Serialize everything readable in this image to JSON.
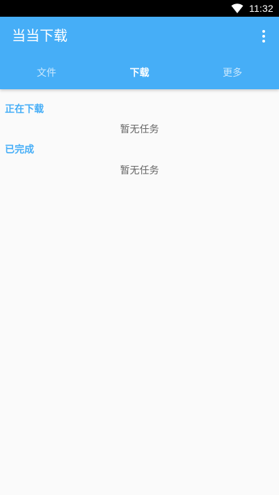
{
  "status_bar": {
    "time": "11:32",
    "icons": [
      "wifi-icon"
    ]
  },
  "app_bar": {
    "title": "当当下载",
    "menu_icon": "more-vert-icon",
    "background_color": "#46aef7"
  },
  "tabs": [
    {
      "label": "文件",
      "active": false
    },
    {
      "label": "下载",
      "active": true
    },
    {
      "label": "更多",
      "active": false
    }
  ],
  "sections": [
    {
      "title": "正在下载",
      "empty_text": "暂无任务"
    },
    {
      "title": "已完成",
      "empty_text": "暂无任务"
    }
  ],
  "colors": {
    "accent": "#46aef7",
    "background": "#fafafa",
    "status_bar": "#000000"
  }
}
